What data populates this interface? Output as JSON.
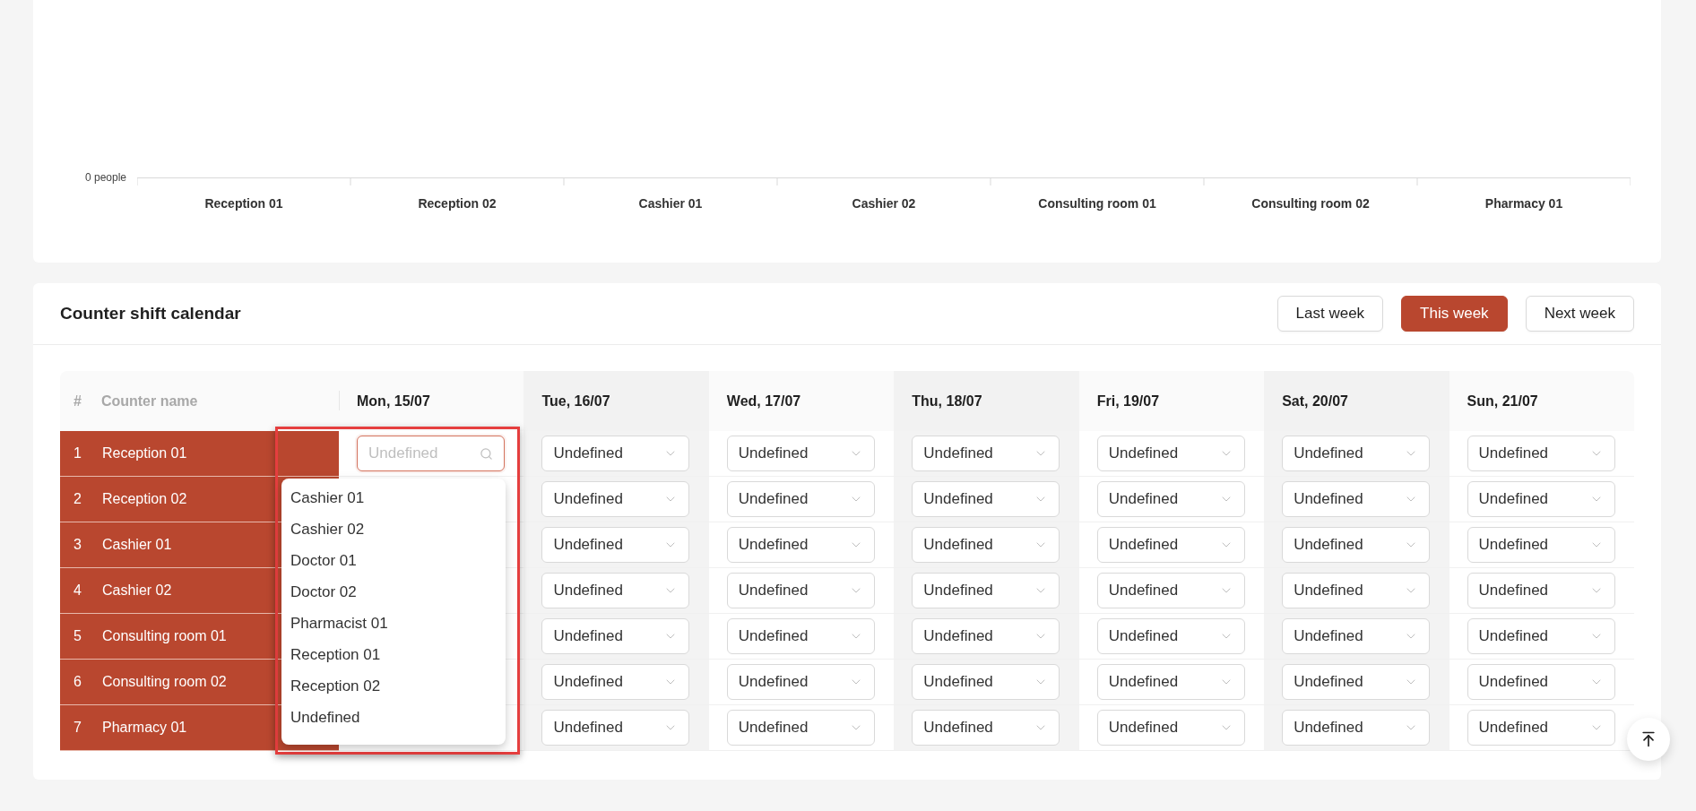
{
  "chart": {
    "y_tick_label": "0 people",
    "categories": [
      "Reception 01",
      "Reception 02",
      "Cashier 01",
      "Cashier 02",
      "Consulting room 01",
      "Consulting room 02",
      "Pharmacy 01"
    ]
  },
  "calendar": {
    "title": "Counter shift calendar",
    "week_buttons": [
      {
        "label": "Last week",
        "selected": false
      },
      {
        "label": "This week",
        "selected": true
      },
      {
        "label": "Next week",
        "selected": false
      }
    ],
    "columns": {
      "number": "#",
      "name": "Counter name",
      "days": [
        "Mon, 15/07",
        "Tue, 16/07",
        "Wed, 17/07",
        "Thu, 18/07",
        "Fri, 19/07",
        "Sat, 20/07",
        "Sun, 21/07"
      ]
    },
    "rows": [
      {
        "number": "1",
        "name": "Reception 01",
        "cells": [
          {
            "kind": "open",
            "placeholder": "Undefined"
          },
          {
            "kind": "select",
            "value": "Undefined"
          },
          {
            "kind": "select",
            "value": "Undefined"
          },
          {
            "kind": "select",
            "value": "Undefined"
          },
          {
            "kind": "select",
            "value": "Undefined"
          },
          {
            "kind": "select",
            "value": "Undefined"
          },
          {
            "kind": "select",
            "value": "Undefined"
          }
        ]
      },
      {
        "number": "2",
        "name": "Reception 02",
        "cells": [
          {
            "kind": "covered"
          },
          {
            "kind": "select",
            "value": "Undefined"
          },
          {
            "kind": "select",
            "value": "Undefined"
          },
          {
            "kind": "select",
            "value": "Undefined"
          },
          {
            "kind": "select",
            "value": "Undefined"
          },
          {
            "kind": "select",
            "value": "Undefined"
          },
          {
            "kind": "select",
            "value": "Undefined"
          }
        ]
      },
      {
        "number": "3",
        "name": "Cashier 01",
        "cells": [
          {
            "kind": "covered"
          },
          {
            "kind": "select",
            "value": "Undefined"
          },
          {
            "kind": "select",
            "value": "Undefined"
          },
          {
            "kind": "select",
            "value": "Undefined"
          },
          {
            "kind": "select",
            "value": "Undefined"
          },
          {
            "kind": "select",
            "value": "Undefined"
          },
          {
            "kind": "select",
            "value": "Undefined"
          }
        ]
      },
      {
        "number": "4",
        "name": "Cashier 02",
        "cells": [
          {
            "kind": "covered"
          },
          {
            "kind": "select",
            "value": "Undefined"
          },
          {
            "kind": "select",
            "value": "Undefined"
          },
          {
            "kind": "select",
            "value": "Undefined"
          },
          {
            "kind": "select",
            "value": "Undefined"
          },
          {
            "kind": "select",
            "value": "Undefined"
          },
          {
            "kind": "select",
            "value": "Undefined"
          }
        ]
      },
      {
        "number": "5",
        "name": "Consulting room 01",
        "cells": [
          {
            "kind": "covered"
          },
          {
            "kind": "select",
            "value": "Undefined"
          },
          {
            "kind": "select",
            "value": "Undefined"
          },
          {
            "kind": "select",
            "value": "Undefined"
          },
          {
            "kind": "select",
            "value": "Undefined"
          },
          {
            "kind": "select",
            "value": "Undefined"
          },
          {
            "kind": "select",
            "value": "Undefined"
          }
        ]
      },
      {
        "number": "6",
        "name": "Consulting room 02",
        "cells": [
          {
            "kind": "covered"
          },
          {
            "kind": "select",
            "value": "Undefined"
          },
          {
            "kind": "select",
            "value": "Undefined"
          },
          {
            "kind": "select",
            "value": "Undefined"
          },
          {
            "kind": "select",
            "value": "Undefined"
          },
          {
            "kind": "select",
            "value": "Undefined"
          },
          {
            "kind": "select",
            "value": "Undefined"
          }
        ]
      },
      {
        "number": "7",
        "name": "Pharmacy 01",
        "cells": [
          {
            "kind": "covered"
          },
          {
            "kind": "select",
            "value": "Undefined"
          },
          {
            "kind": "select",
            "value": "Undefined"
          },
          {
            "kind": "select",
            "value": "Undefined"
          },
          {
            "kind": "select",
            "value": "Undefined"
          },
          {
            "kind": "select",
            "value": "Undefined"
          },
          {
            "kind": "select",
            "value": "Undefined"
          }
        ]
      }
    ],
    "dropdown_options": [
      "Cashier 01",
      "Cashier 02",
      "Doctor 01",
      "Doctor 02",
      "Pharmacist 01",
      "Reception 01",
      "Reception 02",
      "Undefined"
    ]
  }
}
